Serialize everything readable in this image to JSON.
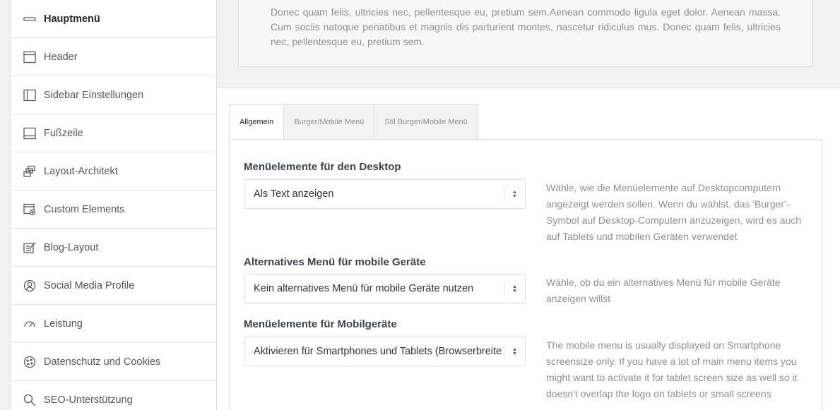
{
  "sidebar": {
    "items": [
      {
        "label": "Hauptmenü",
        "icon": "main-menu-icon",
        "active": true
      },
      {
        "label": "Header",
        "icon": "header-icon"
      },
      {
        "label": "Sidebar Einstellungen",
        "icon": "sidebar-icon"
      },
      {
        "label": "Fußzeile",
        "icon": "footer-icon"
      },
      {
        "label": "Layout-Architekt",
        "icon": "layout-icon"
      },
      {
        "label": "Custom Elements",
        "icon": "custom-elements-icon"
      },
      {
        "label": "Blog-Layout",
        "icon": "blog-icon"
      },
      {
        "label": "Social Media Profile",
        "icon": "social-icon"
      },
      {
        "label": "Leistung",
        "icon": "performance-icon"
      },
      {
        "label": "Datenschutz und Cookies",
        "icon": "cookie-icon"
      },
      {
        "label": "SEO-Unterstützung",
        "icon": "search-icon"
      }
    ]
  },
  "intro_text": "Donec quam felis, ultricies nec, pellentesque eu, pretium sem.Aenean commodo ligula eget dolor. Aenean massa. Cum sociis natoque penatibus et magnis dis parturient montes, nascetur ridiculus mus. Donec quam felis, ultricies nec, pellentesque eu, pretium sem.",
  "tabs": [
    {
      "label": "Allgemein",
      "active": true
    },
    {
      "label": "Burger/Mobile Menü"
    },
    {
      "label": "Stil Burger/Mobile Menü"
    }
  ],
  "settings": {
    "desktop": {
      "title": "Menüelemente für den Desktop",
      "value": "Als Text anzeigen",
      "help": "Wähle, wie die Menüelemente auf Desktopcomputern angezeigt werden sollen. Wenn du wählst, das 'Burger'-Symbol auf Desktop-Computern anzuzeigen, wird es auch auf Tablets und mobilen Geräten verwendet"
    },
    "alternative": {
      "title": "Alternatives Menü für mobile Geräte",
      "value": "Kein alternatives Menü für mobile Geräte nutzen",
      "help": "Wähle, ob du ein alternatives Menü für mobile Geräte anzeigen willst"
    },
    "mobile": {
      "title": "Menüelemente für Mobilgeräte",
      "value": "Aktivieren für Smartphones und Tablets (Browserbreite",
      "help": "The mobile menu is usually displayed on Smartphone screensize only. If you have a lot of main menu items you might want to activate it for tablet screen size as well so it doesn't overlap the logo on tablets or small screens"
    }
  }
}
